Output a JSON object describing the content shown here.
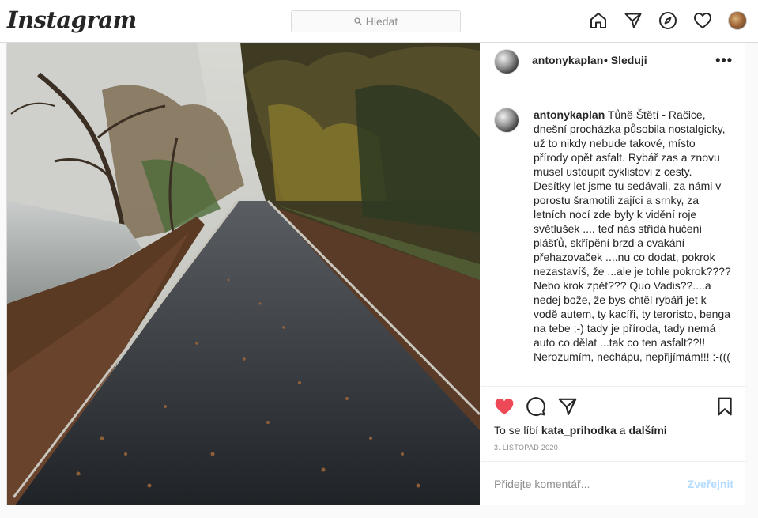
{
  "nav": {
    "logo": "Instagram",
    "search_placeholder": "Hledat",
    "icons": [
      "home-icon",
      "direct-icon",
      "explore-icon",
      "heart-icon",
      "profile-avatar"
    ]
  },
  "post": {
    "username": "antonykaplan",
    "follow_status": "• Sleduji",
    "more_label": "•••",
    "caption_username": "antonykaplan",
    "caption_text": "Tůně Štětí - Račice, dnešní procházka působila nostalgicky, už to nikdy nebude takové, místo přírody opět asfalt. Rybář zas a znovu musel ustoupit cyklistovi z cesty. Desítky let jsme tu sedávali, za námi v porostu šramotili zajíci a srnky, za letních nocí zde byly k vidění roje světlušek .... teď nás střídá hučení plášťů, skřípění brzd a cvakání přehazovaček ....nu co dodat, pokrok nezastavíš, že ...ale je tohle pokrok???? Nebo krok zpět??? Quo Vadis??....a nedej bože, že bys chtěl rybáři jet k vodě autem, ty kacíři, ty teroristo, benga na tebe ;-) tady je příroda, tady nemá auto co dělat ...tak co ten asfalt??!! Nerozumím, nechápu, nepřijímám!!! :-(((",
    "liked": true,
    "likes_prefix": "To se líbí",
    "likes_user": "kata_prihodka",
    "likes_joiner": "a",
    "likes_others": "dalšími",
    "date": "3. LISTOPAD 2020",
    "comment_placeholder": "Přidejte komentář...",
    "post_button": "Zveřejnit"
  },
  "colors": {
    "like_red": "#ed4956",
    "post_button_disabled": "#b3dbff",
    "border": "#dbdbdb"
  }
}
